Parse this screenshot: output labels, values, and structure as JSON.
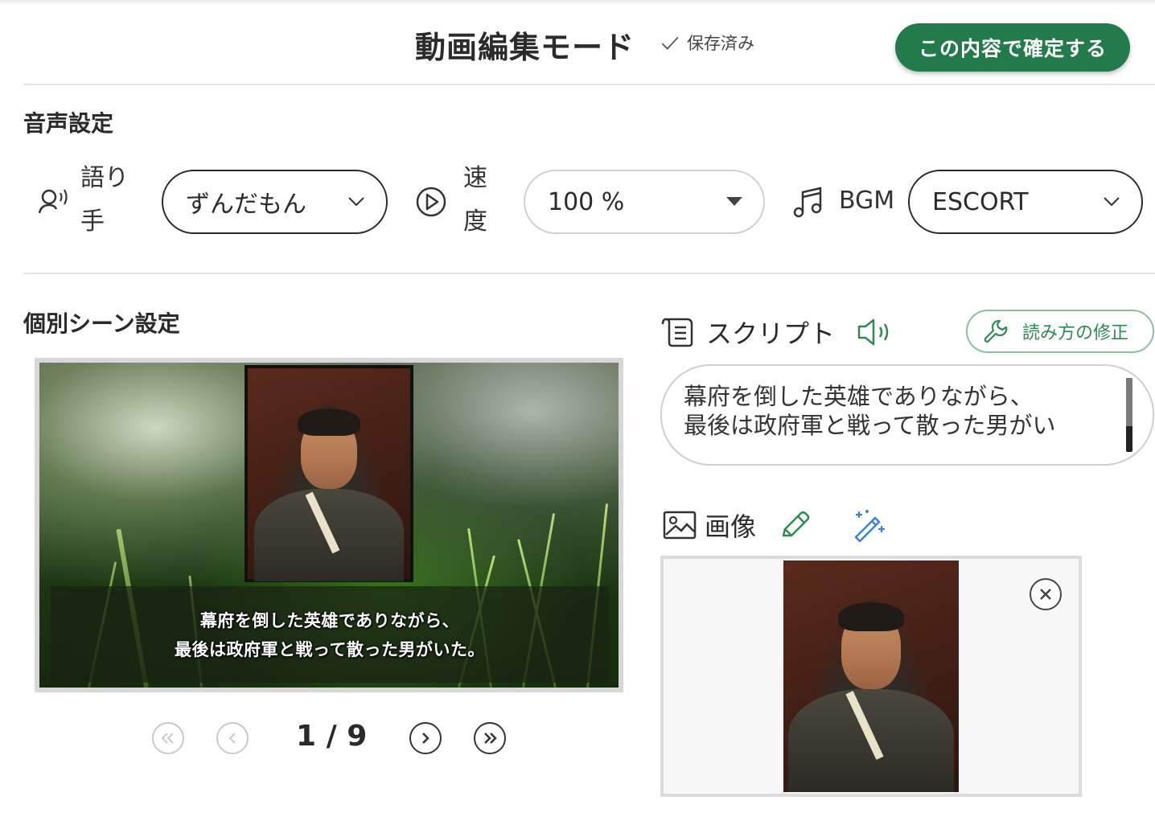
{
  "header": {
    "title": "動画編集モード",
    "saved_status": "保存済み",
    "confirm_label": "この内容で確定する"
  },
  "voice_settings": {
    "section_title": "音声設定",
    "narrator": {
      "label": "語り手",
      "label_line1": "語り",
      "label_line2": "手",
      "value": "ずんだもん",
      "icon": "narrator-icon"
    },
    "speed": {
      "label": "速度",
      "label_line1": "速",
      "label_line2": "度",
      "value": "100 %",
      "icon": "play-circle-icon"
    },
    "bgm": {
      "label": "BGM",
      "value": "ESCORT",
      "icon": "music-note-icon"
    }
  },
  "scene_settings": {
    "section_title": "個別シーン設定",
    "subtitle_line1": "幕府を倒した英雄でありながら、",
    "subtitle_line2": "最後は政府軍と戦って散った男がいた。",
    "pager": {
      "current": 1,
      "total": 9,
      "display": "1 / 9"
    }
  },
  "script": {
    "label": "スクリプト",
    "fix_reading_label": "読み方の修正",
    "text_line1": "幕府を倒した英雄でありながら、",
    "text_line2": "最後は政府軍と戦って散った男がい"
  },
  "image": {
    "label": "画像"
  },
  "colors": {
    "accent_green": "#237a4b",
    "light_green": "#2f8a52",
    "edit_icon_blue": "#3b82d6"
  }
}
